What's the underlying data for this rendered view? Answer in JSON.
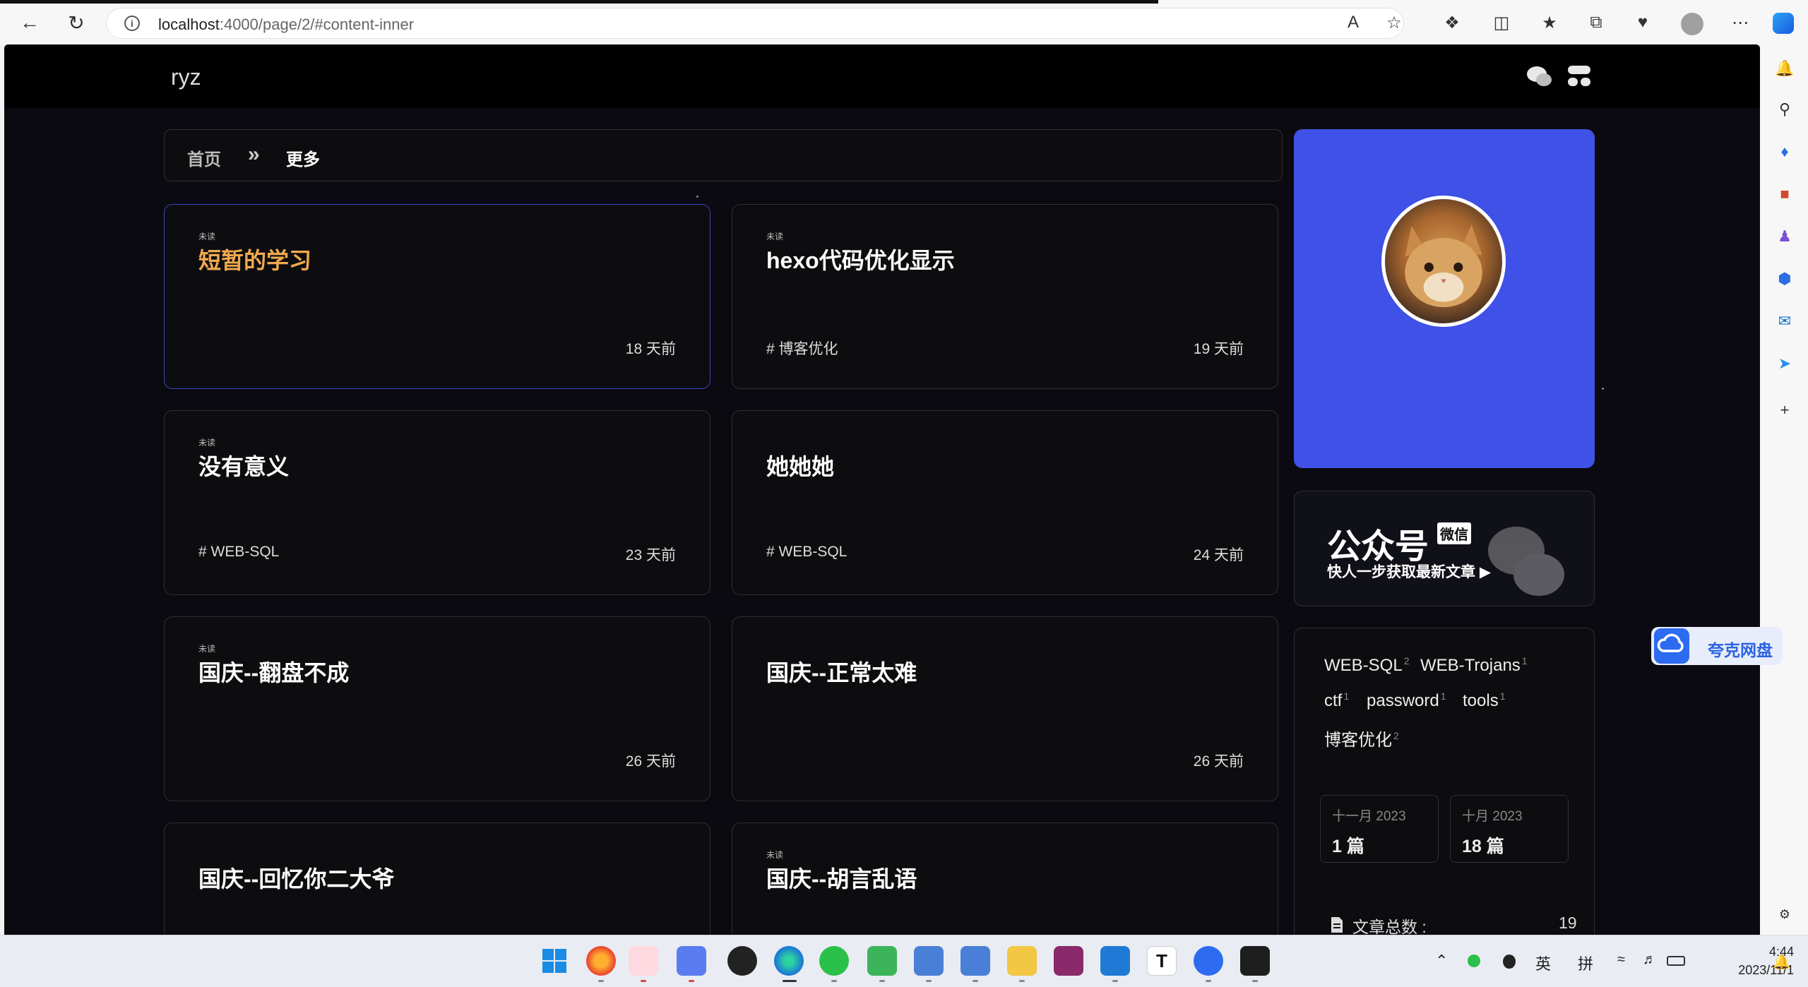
{
  "browser": {
    "url_host": "localhost",
    "url_rest": ":4000/page/2/#content-inner"
  },
  "site": {
    "name": "ryz"
  },
  "breadcrumb": {
    "home": "首页",
    "separator": "»",
    "current": "更多"
  },
  "posts": [
    {
      "unread": "未读",
      "title": "短暂的学习",
      "tag": "",
      "date": "18 天前"
    },
    {
      "unread": "未读",
      "title": "hexo代码优化显示",
      "tag": "# 博客优化",
      "date": "19 天前"
    },
    {
      "unread": "未读",
      "title": "没有意义",
      "tag": "# WEB-SQL",
      "date": "23 天前"
    },
    {
      "unread": "",
      "title": "她她她",
      "tag": "# WEB-SQL",
      "date": "24 天前"
    },
    {
      "unread": "未读",
      "title": "国庆--翻盘不成",
      "tag": "",
      "date": "26 天前"
    },
    {
      "unread": "",
      "title": "国庆--正常太难",
      "tag": "",
      "date": "26 天前"
    },
    {
      "unread": "",
      "title": "国庆--回忆你二大爷",
      "tag": "",
      "date": ""
    },
    {
      "unread": "未读",
      "title": "国庆--胡言乱语",
      "tag": "",
      "date": ""
    }
  ],
  "wechat": {
    "title": "公众号",
    "badge": "微信",
    "subtitle": "快人一步获取最新文章 ▶"
  },
  "tags": [
    {
      "name": "WEB-SQL",
      "count": "2"
    },
    {
      "name": "WEB-Trojans",
      "count": "1"
    },
    {
      "name": "ctf",
      "count": "1"
    },
    {
      "name": "password",
      "count": "1"
    },
    {
      "name": "tools",
      "count": "1"
    },
    {
      "name": "博客优化",
      "count": "2"
    }
  ],
  "archives": [
    {
      "month": "十一月 2023",
      "count": "1 篇"
    },
    {
      "month": "十月 2023",
      "count": "18 篇"
    }
  ],
  "stats": {
    "label": "文章总数 :",
    "value": "19"
  },
  "quark": {
    "label": "夸克网盘"
  },
  "taskbar": {
    "ime_lang": "英",
    "ime_mode": "拼",
    "time": "4:44",
    "date": "2023/11/1"
  },
  "colors": {
    "accent": "#3f51e6",
    "active_title": "#f1a94e",
    "background": "#0a0a10"
  }
}
